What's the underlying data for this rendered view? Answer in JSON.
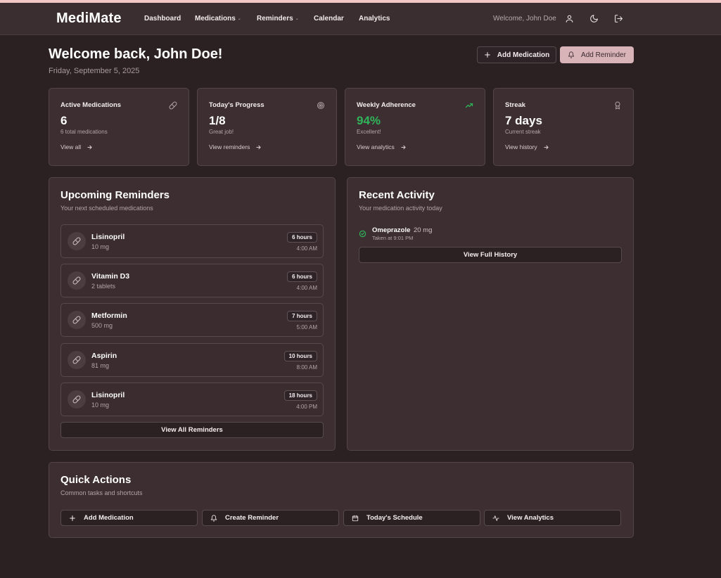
{
  "nav": {
    "brand": "MediMate",
    "links": [
      {
        "label": "Dashboard"
      },
      {
        "label": "Medications",
        "caret": "⌄"
      },
      {
        "label": "Reminders",
        "caret": "⌄"
      },
      {
        "label": "Calendar"
      },
      {
        "label": "Analytics"
      }
    ],
    "welcome": "Welcome, John Doe",
    "icons": [
      "user-icon",
      "moon-icon",
      "logout-icon"
    ]
  },
  "header": {
    "title": "Welcome back, John Doe!",
    "date": "Friday, September 5, 2025",
    "add_medication": "Add Medication",
    "add_reminder": "Add Reminder"
  },
  "stats": [
    {
      "title": "Active Medications",
      "value": "6",
      "sub": "6 total medications",
      "link": "View all",
      "icon": "pill-icon"
    },
    {
      "title": "Today's Progress",
      "value": "1/8",
      "sub": "Great job!",
      "link": "View reminders",
      "icon": "target-icon"
    },
    {
      "title": "Weekly Adherence",
      "value": "94%",
      "sub": "Excellent!",
      "link": "View analytics",
      "icon": "trending-up-icon"
    },
    {
      "title": "Streak",
      "value": "7 days",
      "sub": "Current streak",
      "link": "View history",
      "icon": "award-icon"
    }
  ],
  "reminders": {
    "title": "Upcoming Reminders",
    "subtitle": "Your next scheduled medications",
    "items": [
      {
        "name": "Lisinopril",
        "dose": "10 mg",
        "badge": "6 hours",
        "time": "4:00 AM"
      },
      {
        "name": "Vitamin D3",
        "dose": "2 tablets",
        "badge": "6 hours",
        "time": "4:00 AM"
      },
      {
        "name": "Metformin",
        "dose": "500 mg",
        "badge": "7 hours",
        "time": "5:00 AM"
      },
      {
        "name": "Aspirin",
        "dose": "81 mg",
        "badge": "10 hours",
        "time": "8:00 AM"
      },
      {
        "name": "Lisinopril",
        "dose": "10 mg",
        "badge": "18 hours",
        "time": "4:00 PM"
      }
    ],
    "view_all": "View All Reminders"
  },
  "activity": {
    "title": "Recent Activity",
    "subtitle": "Your medication activity today",
    "items": [
      {
        "name": "Omeprazole",
        "dose": "20 mg",
        "time": "Taken at 9:01 PM"
      }
    ],
    "view_history": "View Full History"
  },
  "quick_actions": {
    "title": "Quick Actions",
    "subtitle": "Common tasks and shortcuts",
    "buttons": [
      {
        "label": "Add Medication",
        "icon": "plus-icon"
      },
      {
        "label": "Create Reminder",
        "icon": "bell-icon"
      },
      {
        "label": "Today's Schedule",
        "icon": "calendar-icon"
      },
      {
        "label": "View Analytics",
        "icon": "activity-icon"
      }
    ]
  },
  "colors": {
    "background": "#2b2123",
    "card": "#3c2e31",
    "accent_pink": "#d8b3b8",
    "success_green": "#2fb45a"
  }
}
